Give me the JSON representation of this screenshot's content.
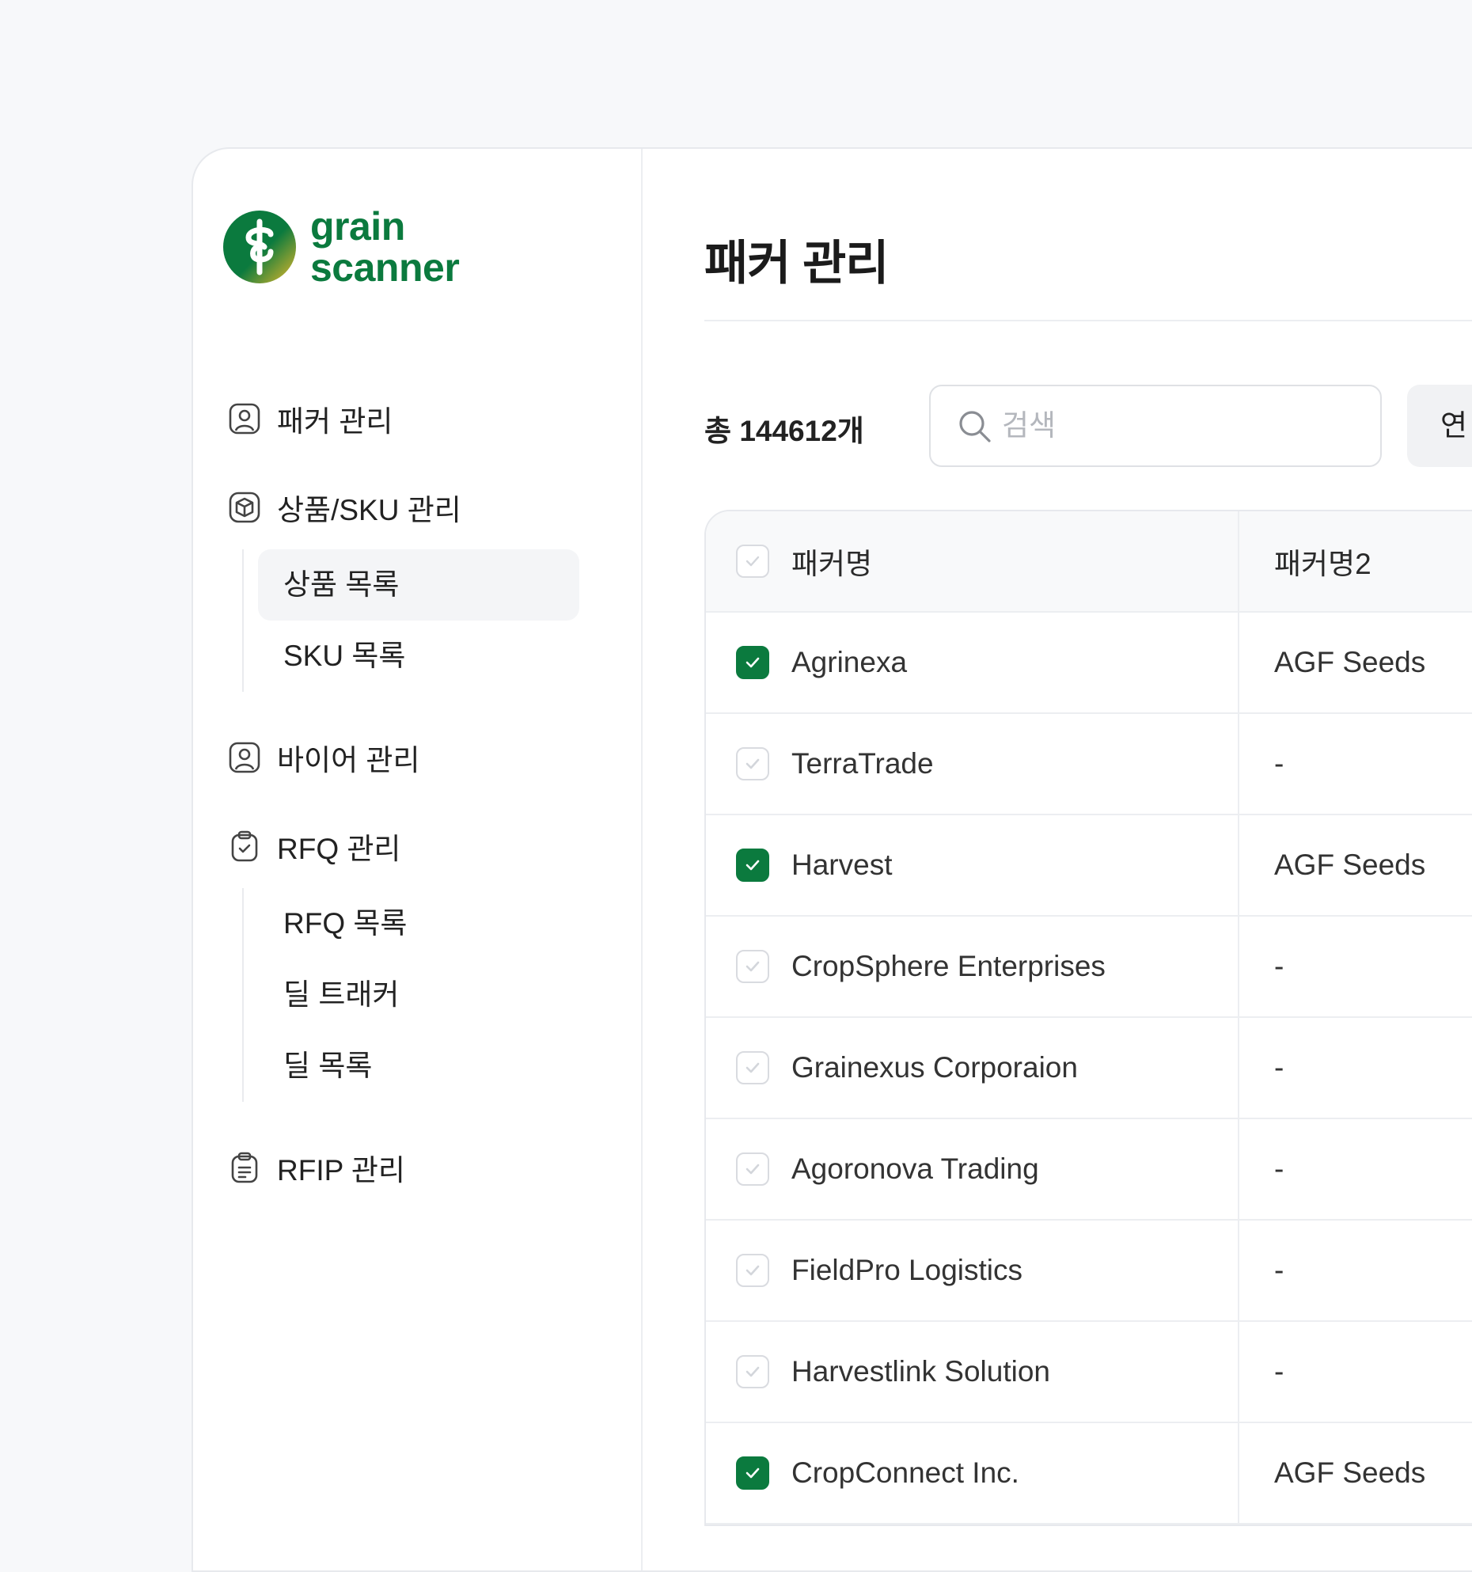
{
  "brand": {
    "line1": "grain",
    "line2": "scanner",
    "color": "#0b7a3e"
  },
  "sidebar": {
    "items": [
      {
        "label": "패커 관리",
        "icon": "user-icon"
      },
      {
        "label": "상품/SKU 관리",
        "icon": "box-icon",
        "children": [
          {
            "label": "상품 목록",
            "active": true
          },
          {
            "label": "SKU 목록"
          }
        ]
      },
      {
        "label": "바이어 관리",
        "icon": "user-icon"
      },
      {
        "label": "RFQ 관리",
        "icon": "clipboard-check-icon",
        "children": [
          {
            "label": "RFQ 목록"
          },
          {
            "label": "딜 트래커"
          },
          {
            "label": "딜 목록"
          }
        ]
      },
      {
        "label": "RFIP 관리",
        "icon": "clipboard-list-icon"
      }
    ]
  },
  "main": {
    "title": "패커 관리",
    "total": "총 144612개",
    "search": {
      "placeholder": "검색",
      "value": ""
    },
    "right_button": "연",
    "table": {
      "columns": [
        "패커명",
        "패커명2"
      ],
      "rows": [
        {
          "name": "Agrinexa",
          "name2": "AGF Seeds",
          "checked": true
        },
        {
          "name": "TerraTrade",
          "name2": "-",
          "checked": false
        },
        {
          "name": "Harvest",
          "name2": "AGF Seeds",
          "checked": true
        },
        {
          "name": "CropSphere Enterprises",
          "name2": "-",
          "checked": false
        },
        {
          "name": "Grainexus Corporaion",
          "name2": "-",
          "checked": false
        },
        {
          "name": "Agoronova Trading",
          "name2": "-",
          "checked": false
        },
        {
          "name": "FieldPro Logistics",
          "name2": "-",
          "checked": false
        },
        {
          "name": "Harvestlink Solution",
          "name2": "-",
          "checked": false
        },
        {
          "name": "CropConnect Inc.",
          "name2": "AGF Seeds",
          "checked": true
        }
      ]
    }
  }
}
